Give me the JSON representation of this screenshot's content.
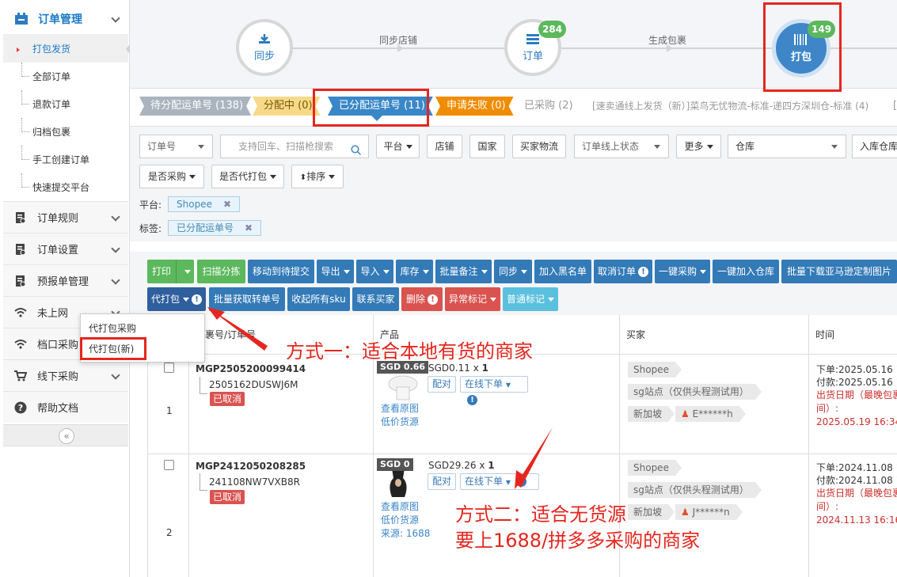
{
  "sidebar": {
    "header": {
      "title": "订单管理",
      "icon": "order-icon"
    },
    "sub_items": [
      {
        "label": "打包发货",
        "active": true
      },
      {
        "label": "全部订单"
      },
      {
        "label": "退款订单"
      },
      {
        "label": "归档包裹"
      },
      {
        "label": "手工创建订单"
      },
      {
        "label": "快速提交平台"
      }
    ],
    "groups": [
      {
        "label": "订单规则",
        "icon": "doc-icon"
      },
      {
        "label": "订单设置",
        "icon": "doc-icon"
      },
      {
        "label": "预报单管理",
        "icon": "doc-icon"
      },
      {
        "label": "未上网",
        "icon": "wifi-icon"
      },
      {
        "label": "档口采购",
        "icon": "wifi-icon"
      },
      {
        "label": "线下采购",
        "icon": "cart-icon"
      },
      {
        "label": "帮助文档",
        "icon": "help-icon"
      }
    ],
    "collapse": "«"
  },
  "workflow": {
    "steps": [
      {
        "label": "同步",
        "icon": "download-icon"
      },
      {
        "label": "订单",
        "icon": "list-icon",
        "badge": "284"
      },
      {
        "label": "打包",
        "icon": "barcode-icon",
        "badge": "149"
      }
    ],
    "connectors": [
      "同步店铺",
      "生成包裹"
    ]
  },
  "status_tabs": [
    {
      "label": "待分配运单号 (138)",
      "color": "#a9b4bf"
    },
    {
      "label": "分配中 (0)",
      "color": "#f7d98a"
    },
    {
      "label": "已分配运单号 (11)",
      "color": "#3a87c8"
    },
    {
      "label": "申请失败 (0)",
      "color": "#f08c00"
    },
    {
      "label": "已采购 (2)"
    },
    {
      "label": "[速卖通线上发货（新）]菜鸟无忧物流-标准-递四方深圳仓-标准 (4)"
    },
    {
      "label": "[S"
    }
  ],
  "filters": {
    "order_no": "订单号",
    "search_placeholder": "支持回车、扫描枪搜索",
    "platform": "平台",
    "shop": "店铺",
    "country": "国家",
    "buyer_logistics": "买家物流",
    "order_online_status": "订单线上状态",
    "more": "更多",
    "warehouse": "仓库",
    "inbound_warehouse": "入库仓库",
    "is_purchased": "是否采购",
    "is_agent_pack": "是否代打包",
    "sort": "排序",
    "platform_label": "平台:",
    "platform_tag": "Shopee",
    "tag_label": "标签:",
    "tag_value": "已分配运单号"
  },
  "toolbar": {
    "row1": [
      "打印",
      "扫描分拣",
      "移动到待提交",
      "导出",
      "导入",
      "库存",
      "批量备注",
      "同步",
      "加入黑名单",
      "取消订单",
      "一键采购",
      "一键加入仓库",
      "批量下载亚马逊定制图片"
    ],
    "row2": [
      "代打包",
      "批量获取转单号",
      "收起所有sku",
      "联系买家",
      "删除",
      "异常标记",
      "普通标记"
    ]
  },
  "dropdown": {
    "items": [
      "代打包采购",
      "代打包(新)"
    ]
  },
  "table": {
    "headers": [
      "裹号/订单号",
      "产品",
      "买家",
      "时间"
    ],
    "rows": [
      {
        "index": "1",
        "package_no": "MGP2505200099414",
        "order_no": "2505162DUSWJ6M",
        "status": "已取消",
        "sgd_badge": "SGD 0.66",
        "price": "SGD0.11 x",
        "qty": "1",
        "match": "配对",
        "online_order": "在线下单",
        "links": [
          "查看原图",
          "低价货源"
        ],
        "buyer": {
          "platform": "Shopee",
          "site": "sg站点（仅供头程测试用）",
          "country": "新加坡",
          "name": "E******h"
        },
        "time": {
          "ordered": "下单:2025.05.16 16",
          "paid": "付款:2025.05.16 16",
          "ship_label": "出货日期（最晚包裹",
          "ship_label2": "间）:",
          "ship_date": "2025.05.19 16:34"
        }
      },
      {
        "index": "2",
        "package_no": "MGP2412050208285",
        "order_no": "241108NW7VXB8R",
        "status": "已取消",
        "sgd_badge": "SGD 0",
        "price": "SGD29.26 x",
        "qty": "1",
        "match": "配对",
        "online_order": "在线下单",
        "links": [
          "查看原图",
          "低价货源",
          "来源: 1688"
        ],
        "buyer": {
          "platform": "Shopee",
          "site": "sg站点（仅供头程测试用）",
          "country": "新加坡",
          "name": "J******n"
        },
        "time": {
          "ordered": "下单:2024.11.08 16",
          "paid": "付款:2024.11.08 16",
          "ship_label": "出货日期（最晚包裹",
          "ship_label2": "间）:",
          "ship_date": "2024.11.13 16:16"
        }
      }
    ]
  },
  "annotations": {
    "method1": "方式一：适合本地有货的商家",
    "method2_line1": "方式二：适合无货源",
    "method2_line2": "要上1688/拼多多采购的商家"
  }
}
